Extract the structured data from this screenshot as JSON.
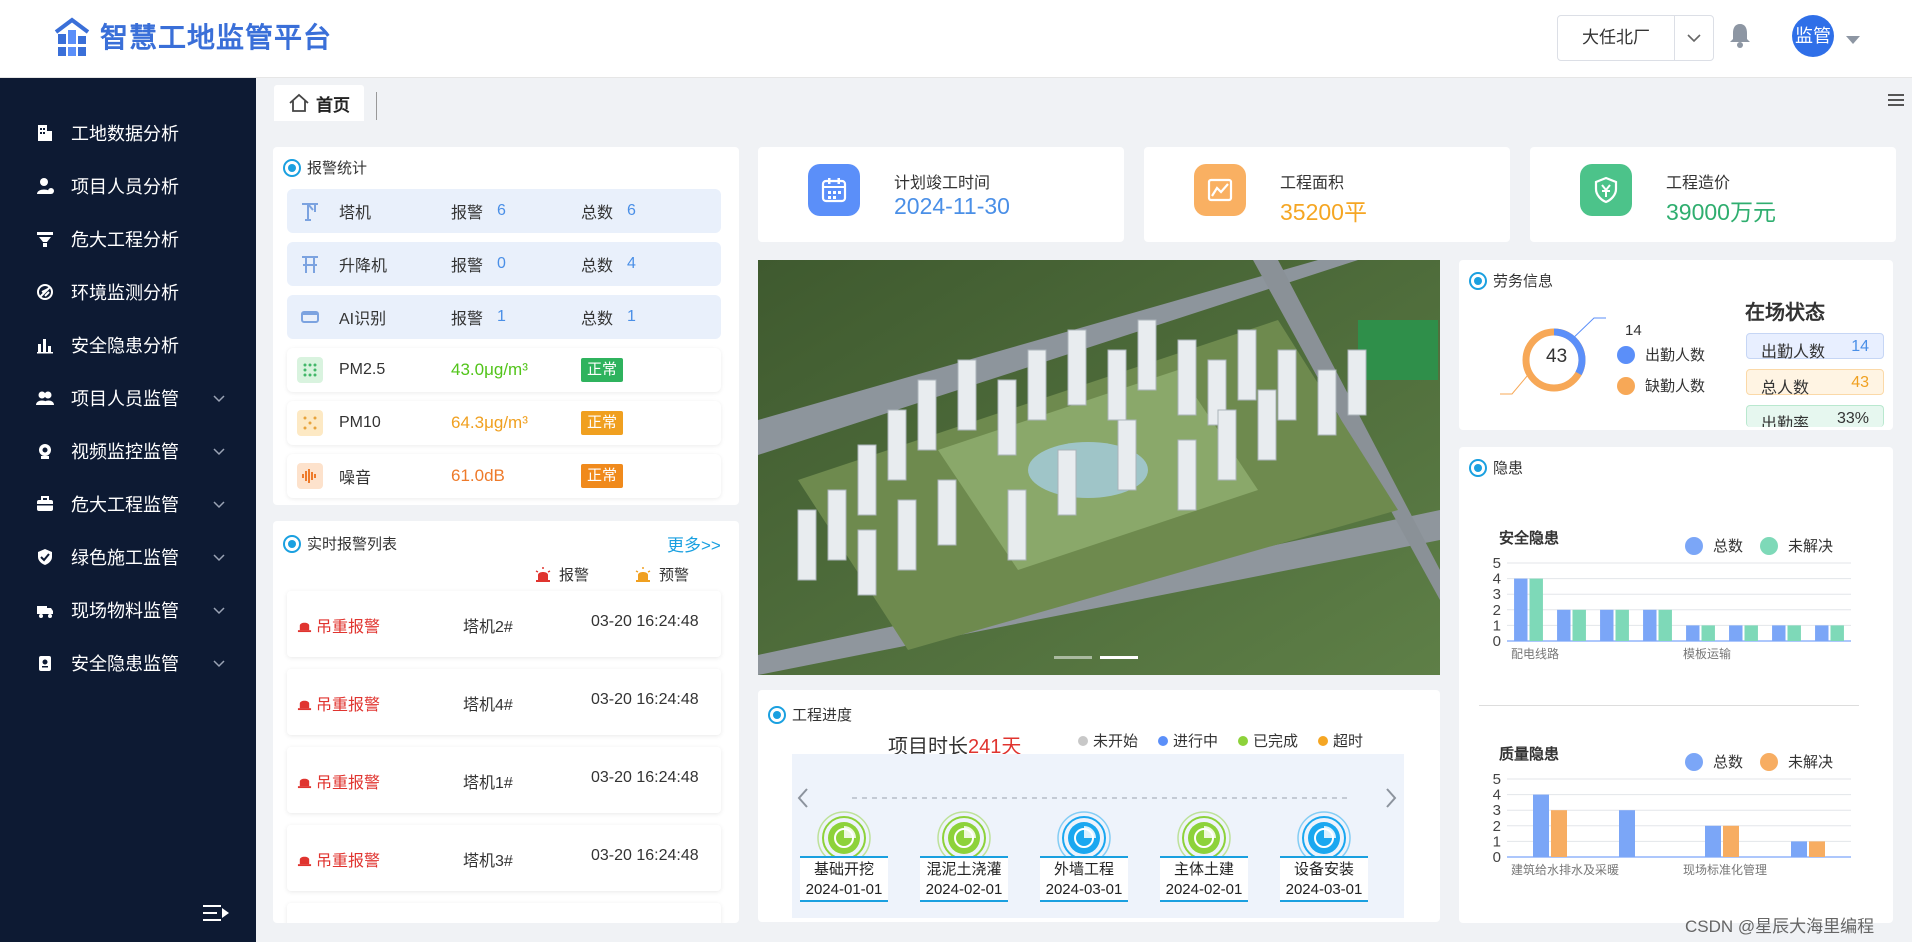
{
  "app": {
    "title": "智慧工地监管平台"
  },
  "header": {
    "site_select": "大任北厂",
    "avatar_text": "监管"
  },
  "sidebar": {
    "items": [
      {
        "label": "工地数据分析",
        "icon": "building-icon",
        "expandable": false
      },
      {
        "label": "项目人员分析",
        "icon": "person-icon",
        "expandable": false
      },
      {
        "label": "危大工程分析",
        "icon": "funnel-icon",
        "expandable": false
      },
      {
        "label": "环境监测分析",
        "icon": "leaf-icon",
        "expandable": false
      },
      {
        "label": "安全隐患分析",
        "icon": "bar-chart-icon",
        "expandable": false
      },
      {
        "label": "项目人员监管",
        "icon": "people-icon",
        "expandable": true
      },
      {
        "label": "视频监控监管",
        "icon": "camera-icon",
        "expandable": true
      },
      {
        "label": "危大工程监管",
        "icon": "toolbox-icon",
        "expandable": true
      },
      {
        "label": "绿色施工监管",
        "icon": "shield-check-icon",
        "expandable": true
      },
      {
        "label": "现场物料监管",
        "icon": "truck-icon",
        "expandable": true
      },
      {
        "label": "安全隐患监管",
        "icon": "clipboard-icon",
        "expandable": true
      }
    ]
  },
  "tabs": {
    "home": "首页"
  },
  "alarm_stats": {
    "title": "报警统计",
    "alarm_key": "报警",
    "total_key": "总数",
    "devices": [
      {
        "name": "塔机",
        "alarm": "6",
        "total": "6",
        "icon": "tower-crane-icon"
      },
      {
        "name": "升降机",
        "alarm": "0",
        "total": "4",
        "icon": "elevator-icon"
      },
      {
        "name": "AI识别",
        "alarm": "1",
        "total": "1",
        "icon": "ai-camera-icon"
      }
    ],
    "env": [
      {
        "name": "PM2.5",
        "value": "43.0μg/m³",
        "status": "正常",
        "color": "#52c41a",
        "icon": "pm25-icon"
      },
      {
        "name": "PM10",
        "value": "64.3μg/m³",
        "status": "正常",
        "color": "#f0a020",
        "icon": "pm10-icon"
      },
      {
        "name": "噪音",
        "value": "61.0dB",
        "status": "正常",
        "color": "#ee7a2a",
        "icon": "noise-icon"
      }
    ]
  },
  "realtime": {
    "title": "实时报警列表",
    "more": "更多>>",
    "legend_alarm": "报警",
    "legend_warning": "预警",
    "rows": [
      {
        "type": "吊重报警",
        "device": "塔机2#",
        "time": "03-20 16:24:48"
      },
      {
        "type": "吊重报警",
        "device": "塔机4#",
        "time": "03-20 16:24:48"
      },
      {
        "type": "吊重报警",
        "device": "塔机1#",
        "time": "03-20 16:24:48"
      },
      {
        "type": "吊重报警",
        "device": "塔机3#",
        "time": "03-20 16:24:48"
      }
    ]
  },
  "stats": [
    {
      "label": "计划竣工时间",
      "value": "2024-11-30",
      "color": "#4a8fe7",
      "icon": "calendar-icon"
    },
    {
      "label": "工程面积",
      "value": "35200平",
      "color": "#f5a623",
      "icon": "area-chart-icon"
    },
    {
      "label": "工程造价",
      "value": "39000万元",
      "color": "#2fae6f",
      "icon": "yuan-shield-icon"
    }
  ],
  "labor": {
    "title": "劳务信息",
    "status_title": "在场状态",
    "center": "43",
    "callout": "14",
    "legend_present": "出勤人数",
    "legend_absent": "缺勤人数",
    "present_label": "出勤人数",
    "present": "14",
    "total_label": "总人数",
    "total": "43",
    "rate_label": "出勤率",
    "rate": "33%",
    "present_fraction": 0.33,
    "colors": {
      "present": "#5b8ff9",
      "absent": "#f7a857"
    }
  },
  "hazards": {
    "title": "隐患",
    "legend_total": "总数",
    "legend_unresolved": "未解决"
  },
  "chart_data": [
    {
      "type": "bar",
      "title": "安全隐患",
      "categories": [
        "配电线路",
        "",
        "",
        "",
        "模板运输",
        "",
        "",
        ""
      ],
      "series": [
        {
          "name": "总数",
          "values": [
            4,
            2,
            2,
            2,
            1,
            1,
            1,
            1
          ],
          "color": "#7ba6f7"
        },
        {
          "name": "未解决",
          "values": [
            4,
            2,
            2,
            2,
            1,
            1,
            1,
            1
          ],
          "color": "#7ed9b8"
        }
      ],
      "ylim": [
        0,
        5
      ],
      "yticks": [
        0,
        1,
        2,
        3,
        4,
        5
      ],
      "legend": "top-right",
      "grid": true
    },
    {
      "type": "bar",
      "title": "质量隐患",
      "categories": [
        "建筑给水排水及采暖",
        "",
        "现场标准化管理",
        ""
      ],
      "series": [
        {
          "name": "总数",
          "values": [
            4,
            3,
            2,
            1
          ],
          "color": "#7ba6f7"
        },
        {
          "name": "未解决",
          "values": [
            3,
            0,
            2,
            1
          ],
          "color": "#f7ad62"
        }
      ],
      "ylim": [
        0,
        5
      ],
      "yticks": [
        0,
        1,
        2,
        3,
        4,
        5
      ],
      "legend": "top-right",
      "grid": true
    }
  ],
  "progress": {
    "title": "工程进度",
    "duration_prefix": "项目时长",
    "duration_value": "241天",
    "legend": [
      {
        "label": "未开始",
        "color": "#c8c8c8"
      },
      {
        "label": "进行中",
        "color": "#5b8ff9"
      },
      {
        "label": "已完成",
        "color": "#8dd23a"
      },
      {
        "label": "超时",
        "color": "#f5a623"
      }
    ],
    "stages": [
      {
        "name": "基础开挖",
        "date": "2024-01-01",
        "state": "done"
      },
      {
        "name": "混泥土浇灌",
        "date": "2024-02-01",
        "state": "done"
      },
      {
        "name": "外墙工程",
        "date": "2024-03-01",
        "state": "active"
      },
      {
        "name": "主体土建",
        "date": "2024-02-01",
        "state": "done"
      },
      {
        "name": "设备安装",
        "date": "2024-03-01",
        "state": "active"
      }
    ]
  },
  "watermark": "CSDN @星辰大海里编程"
}
